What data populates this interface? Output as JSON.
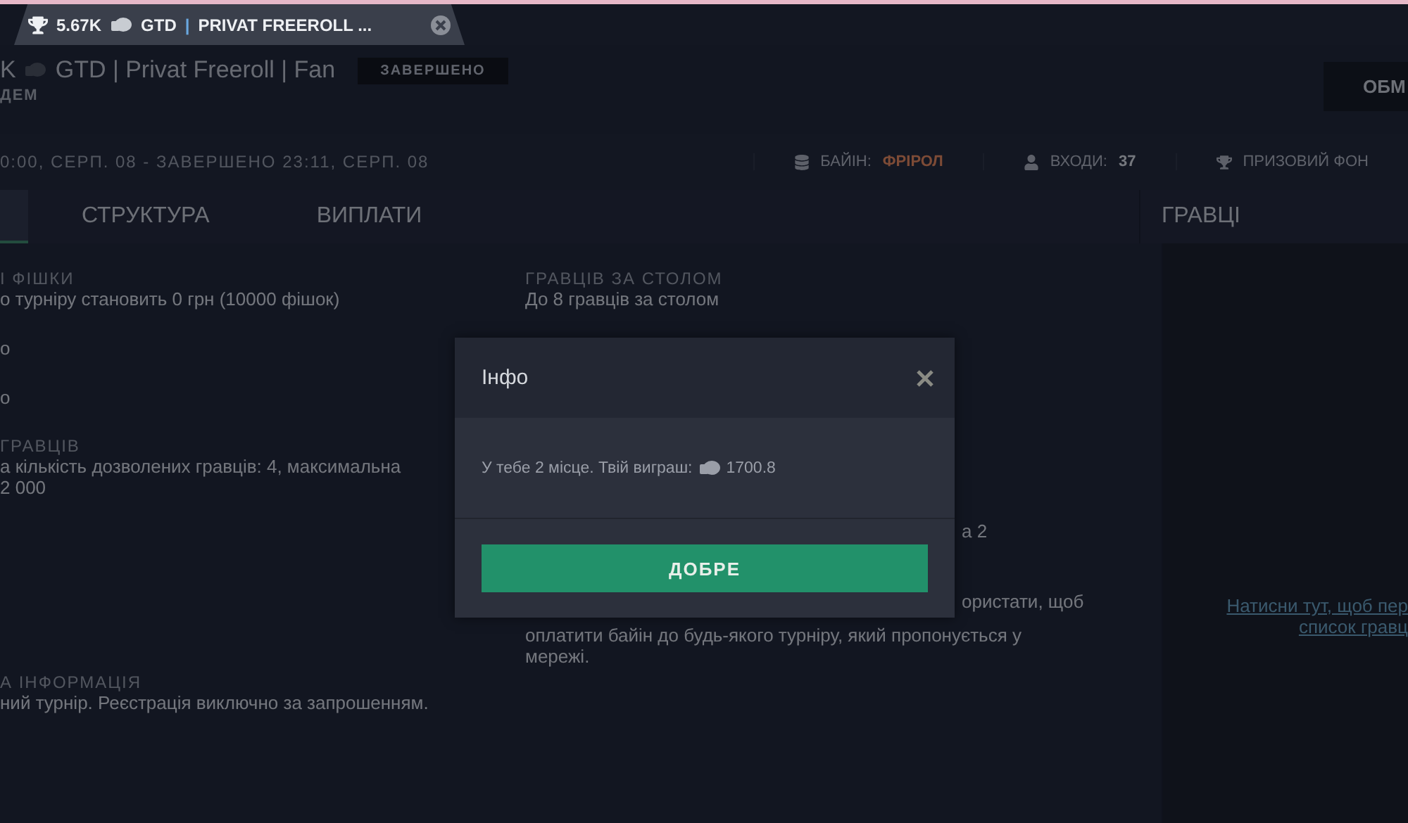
{
  "browser_tab": {
    "prize": "5.67K",
    "currency": "GTD",
    "separator": "|",
    "title": "PRIVAT FREEROLL ..."
  },
  "header": {
    "title_prefix": "K",
    "title": "GTD | Privat Freeroll | Fan",
    "status": "ЗАВЕРШЕНО",
    "subtitle": "ДЕМ",
    "action": "ОБМ"
  },
  "info_bar": {
    "schedule": "0:00, СЕРП. 08 - ЗАВЕРШЕНО 23:11, СЕРП. 08",
    "stats": [
      {
        "kind": "coins",
        "label": "БАЙІН:",
        "value": "ФРІРОЛ"
      },
      {
        "kind": "person",
        "label": "ВХОДИ:",
        "value": "37"
      },
      {
        "kind": "trophy",
        "label": "ПРИЗОВИЙ ФОН"
      }
    ]
  },
  "tabs": [
    {
      "selected": true
    },
    {
      "label": "СТРУКТУРА",
      "selected": false
    },
    {
      "label": "ВИПЛАТИ",
      "selected": false
    }
  ],
  "left_column": [
    {
      "label": "І ФІШКИ",
      "lines": [
        "о турніру становить 0 грн (10000 фішок)"
      ]
    },
    {
      "lines": [
        "о"
      ]
    },
    {
      "lines": [
        "о"
      ]
    },
    {
      "label": "ГРАВЦІВ",
      "lines": [
        "а кількість дозволених гравців: 4, максимальна",
        "2 000"
      ]
    },
    {
      "label": "А ІНФОРМАЦІЯ",
      "lines": [
        "ний турнір. Реєстрація виключно за запрошенням."
      ]
    }
  ],
  "middle_column": [
    {
      "label": "ГРАВЦІВ ЗА СТОЛОМ",
      "lines": [
        "До 8 гравців за столом"
      ]
    },
    {
      "kind": "partial",
      "lines": [
        "а 2"
      ]
    },
    {
      "kind": "partial",
      "lines": [
        "ористати, щоб",
        "оплатити байін до будь-якого турніру, який пропонується у",
        "мережі."
      ]
    }
  ],
  "players_panel": {
    "title": "ГРАВЦІ",
    "link_lines": [
      "Натисни тут, щоб пер",
      "список гравц"
    ]
  },
  "dialog": {
    "title": "Інфо",
    "message": "У тебе 2 місце. Твій виграш:",
    "amount": "1700.8",
    "button": "ДОБРЕ"
  }
}
